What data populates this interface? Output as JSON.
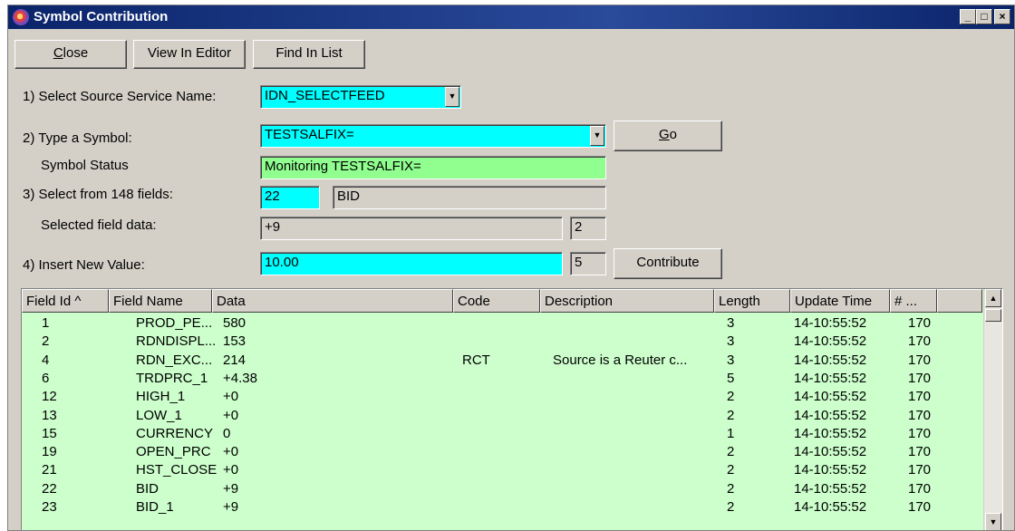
{
  "window": {
    "title": "Symbol Contribution",
    "minimize": "_",
    "maximize": "□",
    "close": "×"
  },
  "toolbar": {
    "close_prefix": "C",
    "close_rest": "lose",
    "view_in_editor": "View In Editor",
    "find_in_list": "Find In List"
  },
  "form": {
    "source_label": "1) Select Source Service Name:",
    "source_value": "IDN_SELECTFEED",
    "symbol_label": "2) Type a Symbol:",
    "symbol_value": "TESTSALFIX=",
    "go_prefix": "G",
    "go_rest": "o",
    "status_label": "Symbol Status",
    "status_value": "Monitoring TESTSALFIX=",
    "fields_label": "3) Select from 148 fields:",
    "field_id": "22",
    "field_name": "BID",
    "field_data_label": "Selected field data:",
    "field_data_value": "+9",
    "field_data_length": "2",
    "new_value_label": "4) Insert New Value:",
    "new_value": "10.00",
    "new_value_length": "5",
    "contribute": "Contribute"
  },
  "table": {
    "headers": [
      "Field Id ^",
      "Field Name",
      "Data",
      "Code",
      "Description",
      "Length",
      "Update Time",
      "# ..."
    ],
    "rows": [
      [
        "1",
        "PROD_PE...",
        "580",
        "",
        "",
        "3",
        "14-10:55:52",
        "170"
      ],
      [
        "2",
        "RDNDISPL...",
        "153",
        "",
        "",
        "3",
        "14-10:55:52",
        "170"
      ],
      [
        "4",
        "RDN_EXC...",
        "214",
        "RCT",
        "Source is a Reuter c...",
        "3",
        "14-10:55:52",
        "170"
      ],
      [
        "6",
        "TRDPRC_1",
        "+4.38",
        "",
        "",
        "5",
        "14-10:55:52",
        "170"
      ],
      [
        "12",
        "HIGH_1",
        "+0",
        "",
        "",
        "2",
        "14-10:55:52",
        "170"
      ],
      [
        "13",
        "LOW_1",
        "+0",
        "",
        "",
        "2",
        "14-10:55:52",
        "170"
      ],
      [
        "15",
        "CURRENCY",
        "0",
        "",
        "",
        "1",
        "14-10:55:52",
        "170"
      ],
      [
        "19",
        "OPEN_PRC",
        "+0",
        "",
        "",
        "2",
        "14-10:55:52",
        "170"
      ],
      [
        "21",
        "HST_CLOSE",
        "+0",
        "",
        "",
        "2",
        "14-10:55:52",
        "170"
      ],
      [
        "22",
        "BID",
        "+9",
        "",
        "",
        "2",
        "14-10:55:52",
        "170"
      ],
      [
        "23",
        "BID_1",
        "+9",
        "",
        "",
        "2",
        "14-10:55:52",
        "170"
      ]
    ]
  },
  "scroll": {
    "up_icon": "▲",
    "down_icon": "▼"
  },
  "dropdown_icon": "▼"
}
